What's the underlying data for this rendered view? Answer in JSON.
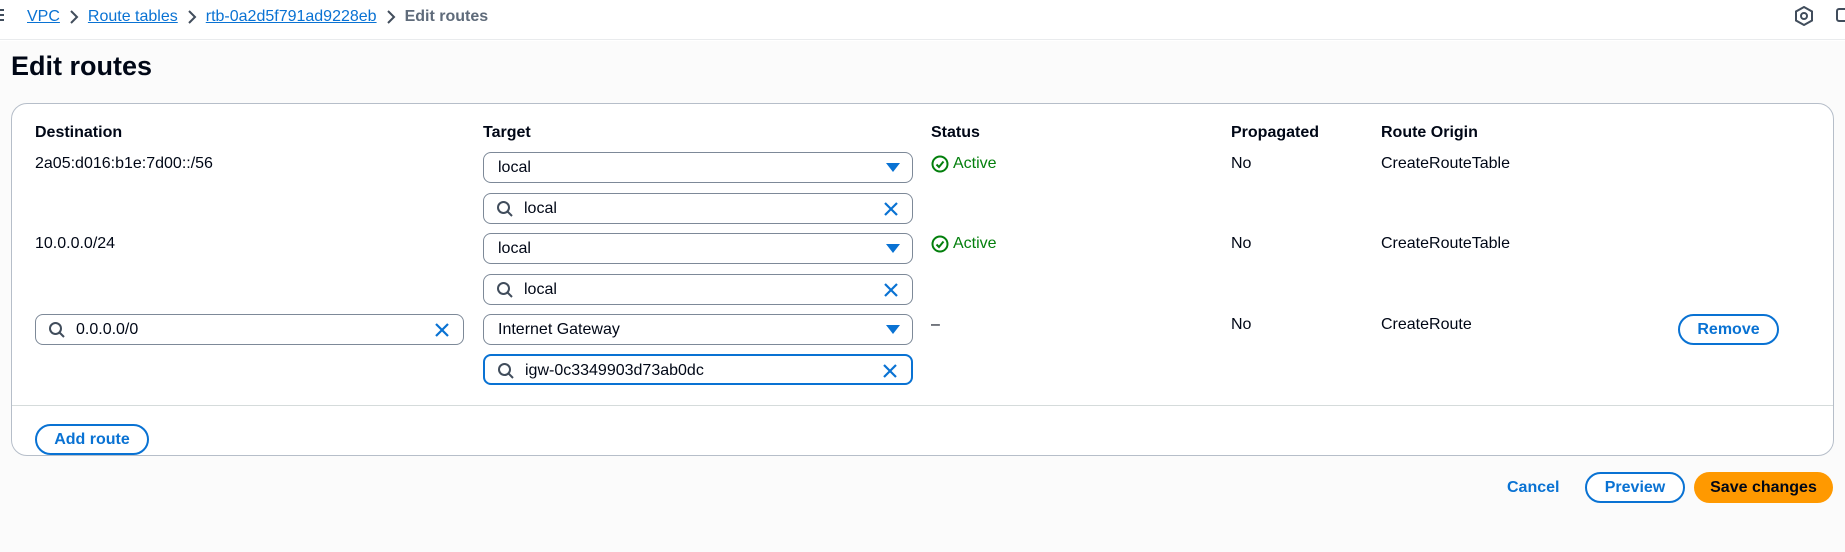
{
  "breadcrumbs": {
    "vpc": "VPC",
    "route_tables": "Route tables",
    "route_table_id": "rtb-0a2d5f791ad9228eb",
    "current": "Edit routes"
  },
  "page": {
    "title": "Edit routes"
  },
  "table": {
    "headers": {
      "destination": "Destination",
      "target": "Target",
      "status": "Status",
      "propagated": "Propagated",
      "route_origin": "Route Origin"
    },
    "rows": [
      {
        "destination": "2a05:d016:b1e:7d00::/56",
        "target_type": "local",
        "target_search": "local",
        "status": "Active",
        "propagated": "No",
        "route_origin": "CreateRouteTable"
      },
      {
        "destination": "10.0.0.0/24",
        "target_type": "local",
        "target_search": "local",
        "status": "Active",
        "propagated": "No",
        "route_origin": "CreateRouteTable"
      },
      {
        "destination": "0.0.0.0/0",
        "target_type": "Internet Gateway",
        "target_search": "igw-0c3349903d73ab0dc",
        "status": "–",
        "propagated": "No",
        "route_origin": "CreateRoute",
        "remove_label": "Remove"
      }
    ],
    "add_route_label": "Add route"
  },
  "actions": {
    "cancel": "Cancel",
    "preview": "Preview",
    "save": "Save changes"
  },
  "colors": {
    "accent": "#0972d3",
    "success": "#037f0c",
    "primary_button": "#ff9900"
  }
}
